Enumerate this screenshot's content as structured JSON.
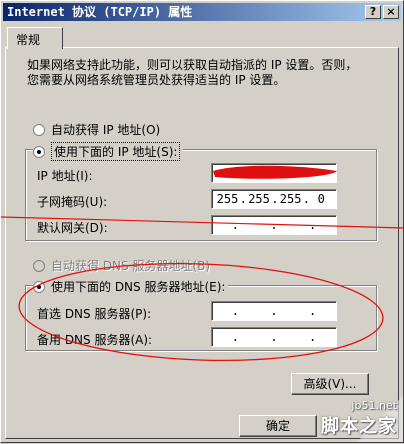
{
  "window": {
    "title": "Internet 协议 (TCP/IP) 属性",
    "help_button": "?",
    "close_button": "×"
  },
  "tabs": [
    {
      "label": "常规"
    }
  ],
  "general": {
    "description_line1": "如果网络支持此功能，则可以获取自动指派的 IP 设置。否则，",
    "description_line2": "您需要从网络系统管理员处获得适当的 IP 设置。",
    "ip": {
      "auto_label": "自动获得 IP 地址(O)",
      "manual_label": "使用下面的 IP 地址(S):",
      "selected": "manual",
      "address_label": "IP 地址(I):",
      "address_value": "",
      "subnet_label": "子网掩码(U):",
      "subnet_octets": [
        "255",
        "255",
        "255",
        "0"
      ],
      "gateway_label": "默认网关(D):",
      "gateway_value": ""
    },
    "dns": {
      "auto_label": "自动获得 DNS 服务器地址(B)",
      "manual_label": "使用下面的 DNS 服务器地址(E):",
      "selected": "manual",
      "preferred_label": "首选 DNS 服务器(P):",
      "preferred_value": "",
      "alternate_label": "备用 DNS 服务器(A):",
      "alternate_value": ""
    },
    "advanced_button": "高级(V)...",
    "ok_button": "确定"
  },
  "colors": {
    "annotation_red": "#e01010",
    "titlebar": "#0a246a",
    "dialog_face": "#d4d0c8"
  },
  "watermark": {
    "url": "jb51.net",
    "text": "脚本之家"
  }
}
